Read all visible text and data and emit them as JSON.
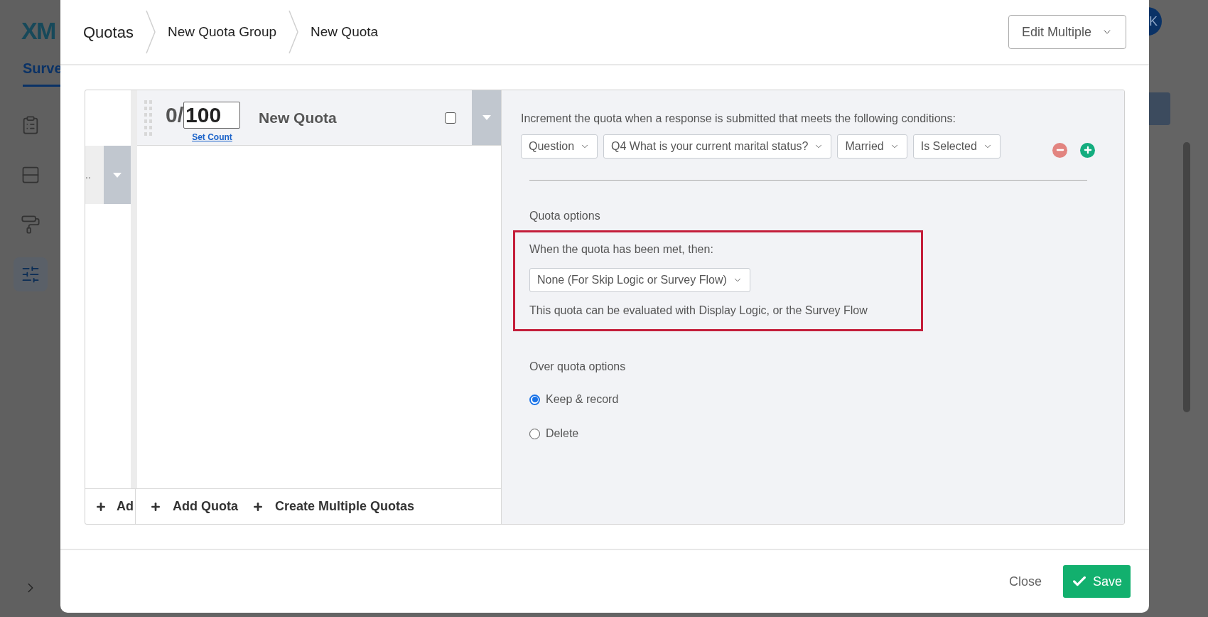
{
  "background": {
    "logo": "XM",
    "tab": "Surve",
    "avatar": "K",
    "sidebar_items": [
      {
        "kind": "clipboard",
        "selected": false
      },
      {
        "kind": "rows",
        "selected": false
      },
      {
        "kind": "roller",
        "selected": false
      },
      {
        "kind": "sliders",
        "selected": true
      }
    ]
  },
  "modal": {
    "breadcrumbs": [
      "Quotas",
      "New Quota Group",
      "New Quota"
    ],
    "edit_multiple": "Edit Multiple",
    "group_list": {
      "item_text": "..",
      "add_label": "Ad"
    },
    "quota": {
      "count": "0/",
      "limit": "100",
      "set_count": "Set Count",
      "name": "New Quota",
      "checked": false
    },
    "quota_actions": [
      "Add Quota",
      "Create Multiple Quotas"
    ],
    "conditions_intro": "Increment the quota when a response is submitted that meets the following conditions:",
    "condition": {
      "dropdowns": [
        "Question",
        "Q4 What is your current marital status?",
        "Married",
        "Is Selected"
      ]
    },
    "quota_options": {
      "heading": "Quota options",
      "met_label": "When the quota has been met, then:",
      "met_value": "None (For Skip Logic or Survey Flow)",
      "hint": "This quota can be evaluated with Display Logic, or the Survey Flow",
      "highlighted": true
    },
    "over_quota": {
      "heading": "Over quota options",
      "options": [
        {
          "label": "Keep & record",
          "selected": true
        },
        {
          "label": "Delete",
          "selected": false
        }
      ]
    },
    "footer": {
      "close": "Close",
      "save": "Save"
    }
  }
}
